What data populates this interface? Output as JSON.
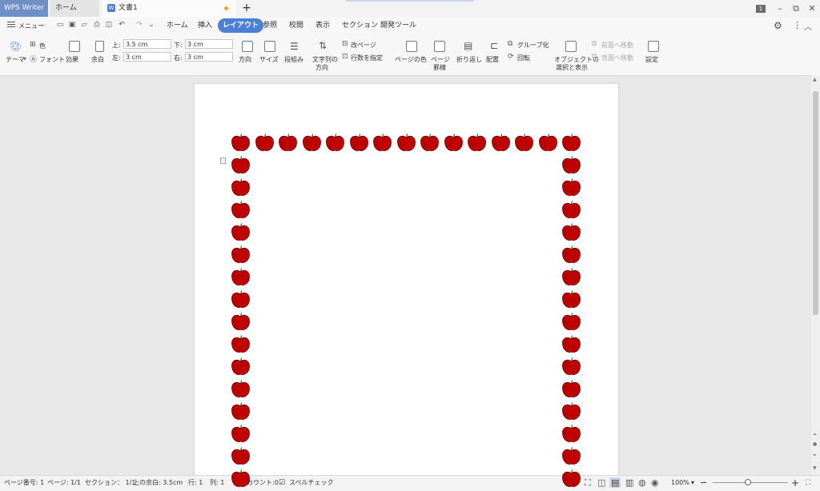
{
  "titlebar": {
    "app_tab": "WPS Writer",
    "home_tab": "ホーム",
    "doc_tab": "文書1",
    "new_tab": "+",
    "window_badge": "1",
    "minimize": "–",
    "restore": "⧉",
    "close": "✕"
  },
  "menubar": {
    "menu_label": "メニュー",
    "tabs": [
      "ホーム",
      "挿入",
      "レイアウト",
      "参照",
      "校閲",
      "表示",
      "セクション",
      "開発ツール"
    ],
    "active_tab": "レイアウト"
  },
  "ribbon": {
    "theme": "テーマ",
    "color": "色",
    "font": "フォント",
    "effect": "効果",
    "margin": "余白",
    "margin_top_label": "上:",
    "margin_top_value": "3.5 cm",
    "margin_left_label": "左:",
    "margin_left_value": "3 cm",
    "margin_bottom_label": "下:",
    "margin_bottom_value": "3 cm",
    "margin_right_label": "右:",
    "margin_right_value": "3 cm",
    "orientation": "方向",
    "size": "サイズ",
    "columns": "段組み",
    "text_direction_1": "文字列の",
    "text_direction_2": "方向",
    "page_break": "改ページ",
    "line_numbers": "行数を指定",
    "page_color": "ページの色",
    "page_border_1": "ページ",
    "page_border_2": "罫線",
    "wrap": "折り返し",
    "align": "配置",
    "group": "グループ化",
    "rotate": "回転",
    "select_pane_1": "オブジェクトの",
    "select_pane_2": "選択と表示",
    "bring_forward": "前面へ移動",
    "send_backward": "背面へ移動",
    "settings": "設定"
  },
  "status": {
    "page_number": "ページ番号: 1",
    "pages": "ページ: 1/1",
    "section": "セクション： 1/1",
    "top_margin": "上の余白: 3.5cm",
    "row": "行: 1",
    "col": "列: 1",
    "word_count": "文字カウント:0",
    "spell_check": "スペルチェック",
    "zoom": "100%",
    "zoom_out": "−",
    "zoom_in": "+"
  },
  "colors": {
    "accent": "#4d7fd6",
    "apple": "#c00000"
  },
  "icons": [
    "hamburger-icon",
    "open-icon",
    "save-icon",
    "undo-icon",
    "redo-icon",
    "gear-icon",
    "apple-border-icon"
  ]
}
